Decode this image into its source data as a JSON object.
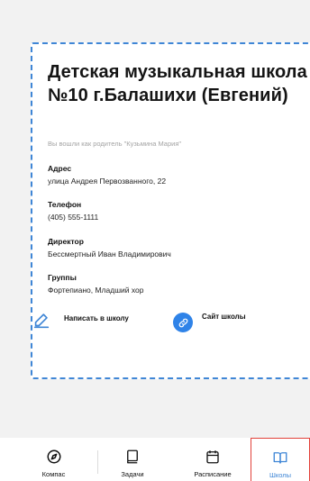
{
  "school": {
    "title": "Детская музыкальная школа №10 г.Балашихи (Евгений)",
    "login_note": "Вы вошли как родитель \"Кузьмина Мария\""
  },
  "fields": {
    "address": {
      "label": "Адрес",
      "value": "улица Андрея Первозванного, 22"
    },
    "phone": {
      "label": "Телефон",
      "value": "(405) 555-1111"
    },
    "director": {
      "label": "Директор",
      "value": "Бессмертный Иван Владимирович"
    },
    "groups": {
      "label": "Группы",
      "value": "Фортепиано, Младший хор"
    }
  },
  "actions": {
    "write": "Написать в школу",
    "site": "Сайт школы"
  },
  "nav": {
    "items": [
      {
        "label": "Компас",
        "icon": "compass-icon"
      },
      {
        "label": "Задачи",
        "icon": "book-icon"
      },
      {
        "label": "Расписание",
        "icon": "calendar-icon"
      },
      {
        "label": "Школы",
        "icon": "open-book-icon",
        "active": true
      }
    ]
  },
  "colors": {
    "accent": "#3f86d6",
    "site_button": "#2f83e8",
    "active_outline": "#e2413a"
  }
}
